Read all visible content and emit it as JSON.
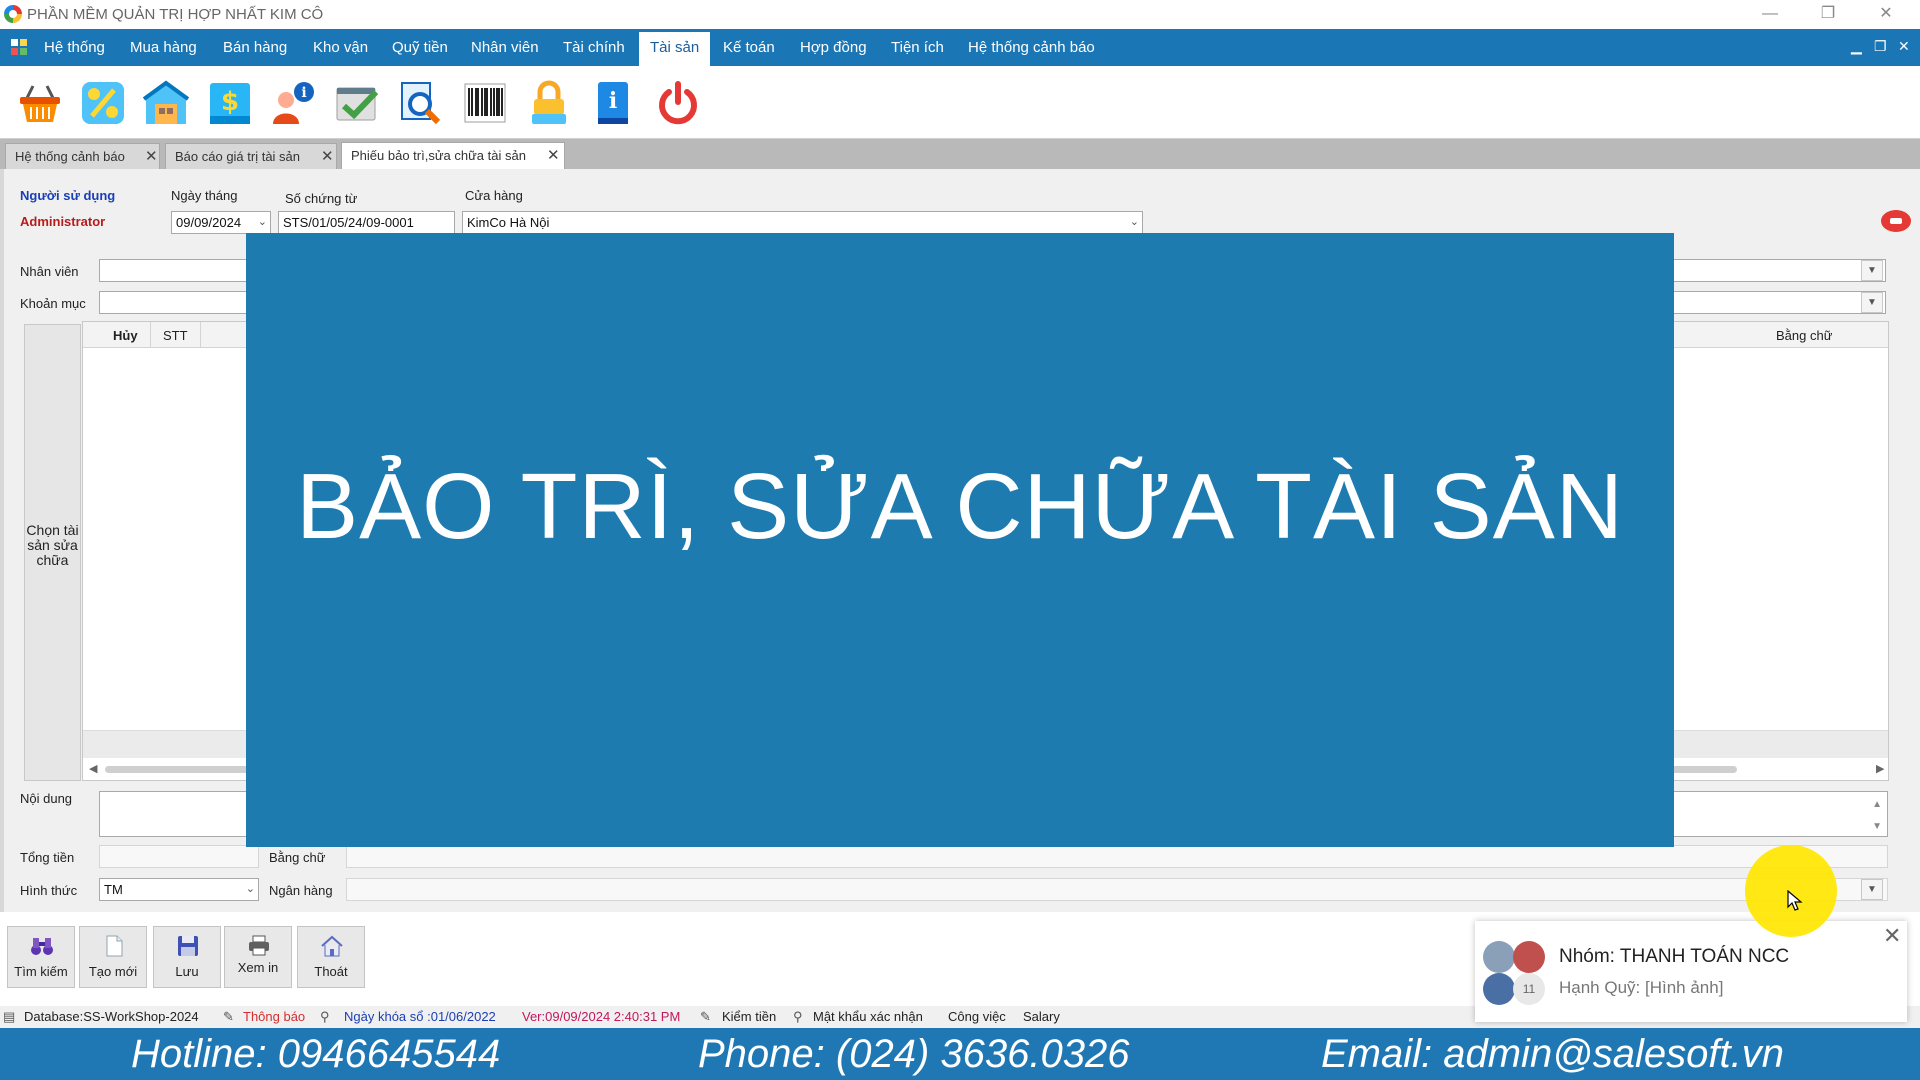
{
  "window": {
    "title": "PHẦN MỀM QUẢN TRỊ HỢP NHẤT KIM CÔ",
    "minimize": "—",
    "restore": "❐",
    "close": "✕"
  },
  "menu": {
    "items": [
      "Hệ thống",
      "Mua hàng",
      "Bán hàng",
      "Kho vận",
      "Quỹ tiền",
      "Nhân viên",
      "Tài chính",
      "Tài sản",
      "Kế toán",
      "Hợp đồng",
      "Tiện ích",
      "Hệ thống cảnh báo"
    ],
    "active": "Tài sản",
    "mdi_min": "▁",
    "mdi_restore": "❐",
    "mdi_close": "✕"
  },
  "toolbar": {
    "icons": [
      "basket-icon",
      "discount-icon",
      "warehouse-icon",
      "cash-book-icon",
      "employee-info-icon",
      "checklist-icon",
      "search-report-icon",
      "barcode-icon",
      "lock-icon",
      "info-book-icon",
      "power-icon"
    ]
  },
  "tabs": [
    {
      "label": "Hệ thống cảnh báo",
      "close": "✕"
    },
    {
      "label": "Báo cáo giá trị tài sản",
      "close": "✕"
    },
    {
      "label": "Phiếu bảo trì,sửa chữa tài sản",
      "close": "✕"
    }
  ],
  "form": {
    "user_label": "Người sử dụng",
    "user_value": "Administrator",
    "date_label": "Ngày tháng",
    "date_value": "09/09/2024",
    "doc_no_label": "Số chứng từ",
    "doc_no_value": "STS/01/05/24/09-0001",
    "store_label": "Cửa hàng",
    "store_value": "KimCo Hà Nội",
    "employee_label": "Nhân viên",
    "account_label": "Khoản mục",
    "grid_columns": [
      "Hủy",
      "STT"
    ],
    "grid_right_column": "Bằng chữ",
    "choose_asset_label": "Chọn tài sản sửa chữa",
    "content_label": "Nội dung",
    "total_label": "Tổng tiền",
    "in_words_label": "Bằng chữ",
    "method_label": "Hình thức",
    "method_value": "TM",
    "bank_label": "Ngân hàng"
  },
  "overlay_title": "BẢO TRÌ, SỬA CHỮA TÀI SẢN",
  "buttons": {
    "search": "Tìm kiếm",
    "new": "Tạo mới",
    "save": "Lưu",
    "print": "Xem in",
    "exit": "Thoát"
  },
  "statusbar": {
    "database": "Database:SS-WorkShop-2024",
    "notice": "Thông báo",
    "lock_date": "Ngày khóa sổ :01/06/2022",
    "version": "Ver:09/09/2024 2:40:31 PM",
    "cash_check": "Kiểm tiền",
    "password": "Mật khẩu xác nhận",
    "work": "Công việc",
    "salary": "Salary"
  },
  "notification": {
    "title": "Nhóm: THANH TOÁN NCC",
    "message": "Hạnh Quỹ: [Hình ảnh]",
    "member_count": "11",
    "close": "✕"
  },
  "footer": {
    "hotline": "Hotline: 0946645544",
    "phone": "Phone: (024) 3636.0326",
    "email": "Email: admin@salesoft.vn"
  },
  "colors": {
    "menu_bg": "#1b76b5",
    "overlay_bg": "#1e7bb0",
    "footer_bg": "#1f78b4",
    "cursor_highlight": "#ffe600"
  }
}
